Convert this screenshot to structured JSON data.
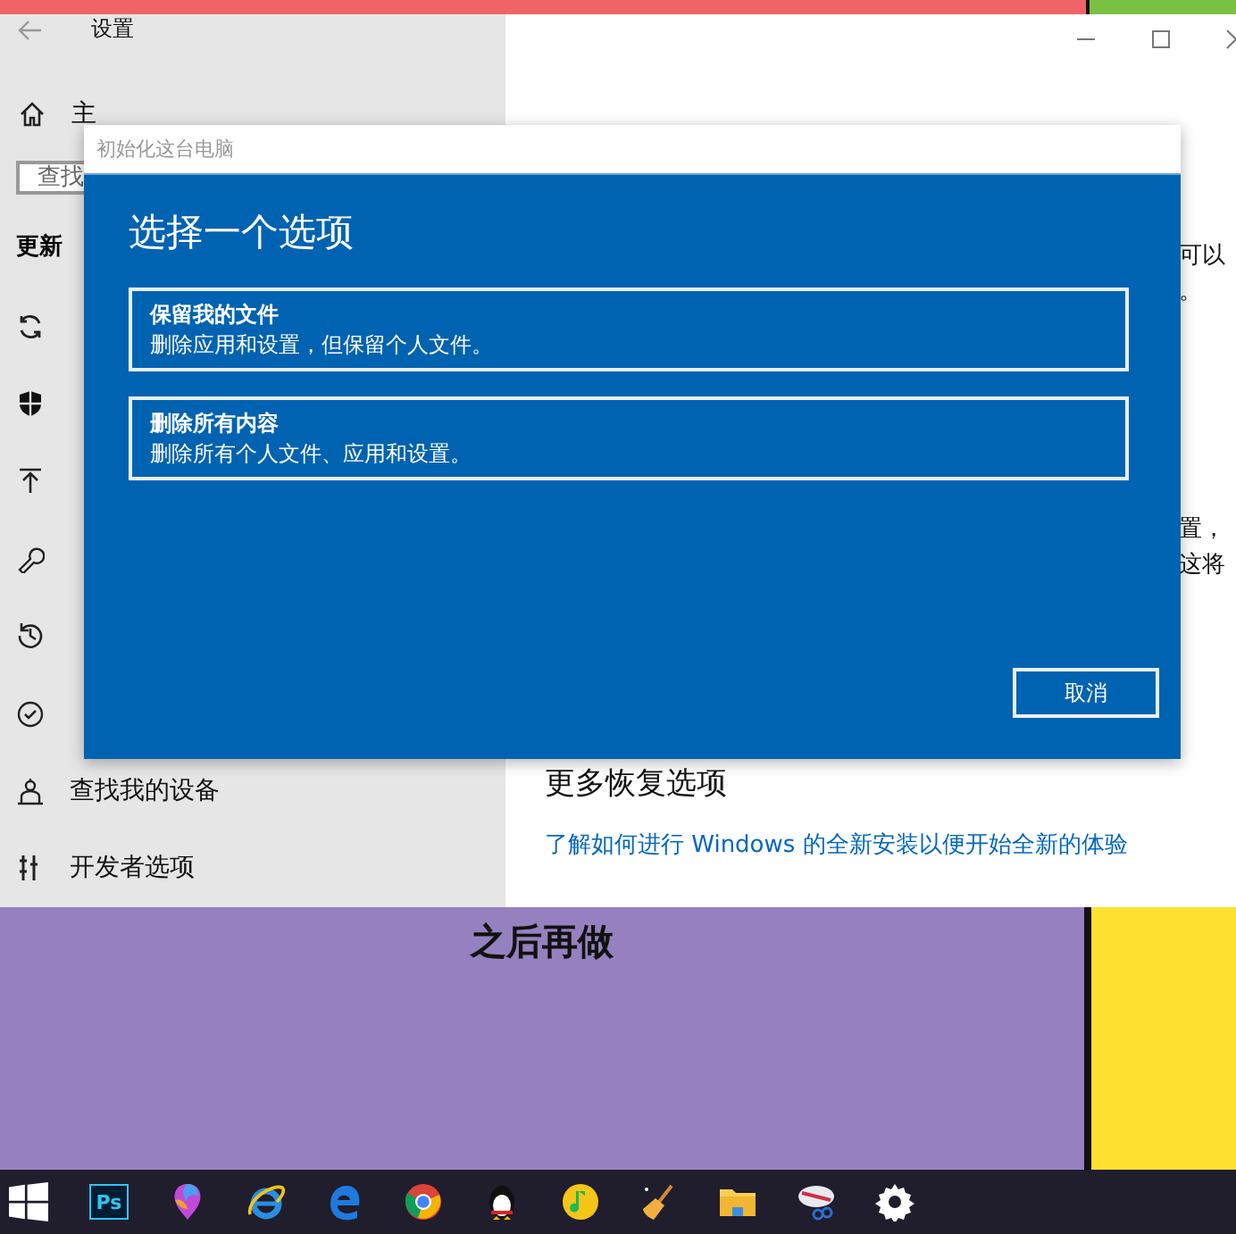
{
  "settings_window": {
    "title": "设置",
    "sidebar": {
      "home": "主",
      "search": {
        "placeholder": "查找"
      },
      "section": "更新",
      "items": [
        {
          "kind": "sync"
        },
        {
          "kind": "shield"
        },
        {
          "kind": "backup"
        },
        {
          "kind": "wrench"
        },
        {
          "kind": "history"
        },
        {
          "kind": "check"
        },
        {
          "kind": "person",
          "label": "查找我的设备"
        },
        {
          "kind": "tools",
          "label": "开发者选项"
        }
      ]
    },
    "main": {
      "fragments": [
        "可以",
        "。",
        "置，",
        "这将"
      ],
      "more_heading": "更多恢复选项",
      "link": "了解如何进行 Windows 的全新安装以便开始全新的体验"
    }
  },
  "dialog": {
    "title": "初始化这台电脑",
    "heading": "选择一个选项",
    "options": [
      {
        "title": "保留我的文件",
        "description": "删除应用和设置，但保留个人文件。"
      },
      {
        "title": "删除所有内容",
        "description": "删除所有个人文件、应用和设置。"
      }
    ],
    "cancel": "取消"
  },
  "background_caption": "之后再做",
  "taskbar": [
    {
      "kind": "start"
    },
    {
      "kind": "ps",
      "label": "Ps"
    },
    {
      "kind": "balloon"
    },
    {
      "kind": "ie"
    },
    {
      "kind": "edge"
    },
    {
      "kind": "chrome"
    },
    {
      "kind": "penguin"
    },
    {
      "kind": "music"
    },
    {
      "kind": "broom"
    },
    {
      "kind": "folder"
    },
    {
      "kind": "snip"
    },
    {
      "kind": "gear"
    }
  ]
}
